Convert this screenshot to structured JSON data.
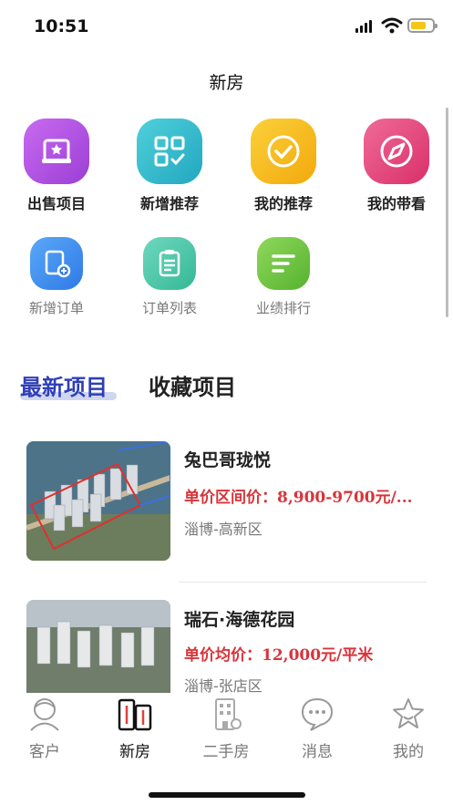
{
  "status_bar": {
    "time": "10:51"
  },
  "nav": {
    "title": "新房"
  },
  "quick_actions": [
    {
      "label": "出售项目",
      "icon": "sale-project-icon",
      "color": "#b44de0"
    },
    {
      "label": "新增推荐",
      "icon": "add-recommend-icon",
      "color": "#2cb8c8"
    },
    {
      "label": "我的推荐",
      "icon": "my-recommend-icon",
      "color": "#f5b511"
    },
    {
      "label": "我的带看",
      "icon": "my-viewing-icon",
      "color": "#e8407a"
    }
  ],
  "secondary_actions": [
    {
      "label": "新增订单",
      "icon": "add-order-icon",
      "color": "#3b8ef0"
    },
    {
      "label": "订单列表",
      "icon": "order-list-icon",
      "color": "#43c6a6"
    },
    {
      "label": "业绩排行",
      "icon": "performance-rank-icon",
      "color": "#6ac23f"
    }
  ],
  "tabs": {
    "active": "最新项目",
    "inactive": "收藏项目"
  },
  "projects": [
    {
      "title": "兔巴哥珑悦",
      "price": "单价区间价：8,900-9700元/...",
      "location": "淄博-高新区"
    },
    {
      "title": "瑞石·海德花园",
      "price": "单价均价：12,000元/平米",
      "location": "淄博-张店区"
    }
  ],
  "bottom_tabs": [
    {
      "label": "客户",
      "icon": "customer-icon"
    },
    {
      "label": "新房",
      "icon": "new-house-icon"
    },
    {
      "label": "二手房",
      "icon": "second-hand-house-icon"
    },
    {
      "label": "消息",
      "icon": "message-icon"
    },
    {
      "label": "我的",
      "icon": "star-profile-icon"
    }
  ],
  "colors": {
    "accent": "#2f3fb8",
    "price": "#d9343a"
  }
}
